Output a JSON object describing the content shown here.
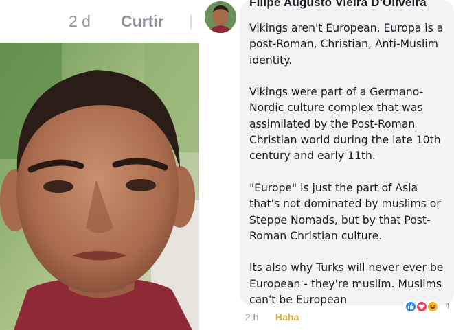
{
  "previous_comment": {
    "time": "2 d",
    "like_label": "Curtir"
  },
  "comment": {
    "author": "Filipe Augusto Vieira D'Oliveira",
    "paragraphs": [
      "Vikings aren't European. Europa is a post-Roman, Christian, Anti-Muslim identity.",
      "Vikings were part of a Germano-Nordic culture complex that was assimilated by the Post-Roman Christian world during the late 10th century and early 11th.",
      "\"Europe\" is just the part of Asia that's not dominated by muslims or Steppe Nomads, but by that Post-Roman Christian culture.",
      "Its also why Turks will never ever be European - they're muslim. Muslims can't be European"
    ],
    "time": "2 h",
    "reaction_label": "Haha",
    "reactions": {
      "icons": [
        "like-icon",
        "love-icon",
        "haha-icon"
      ],
      "count": "4"
    }
  },
  "colors": {
    "bubble": "#f2f3f5",
    "meta_gray": "#8d949e",
    "haha_orange": "#e0a93b",
    "like_blue": "#2d88ff",
    "love_red": "#f33e58",
    "haha_yellow": "#f7b125"
  }
}
